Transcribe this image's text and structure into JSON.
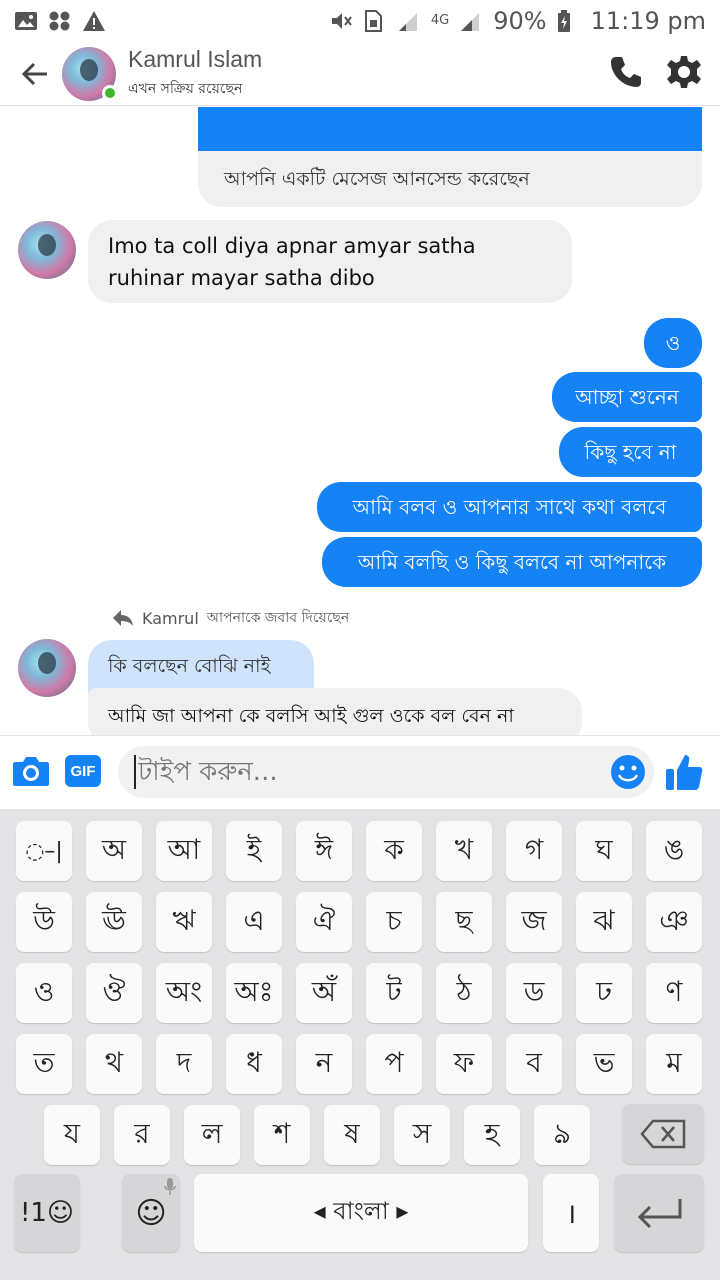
{
  "status_bar": {
    "battery": "90%",
    "time": "11:19 pm",
    "network": "4G"
  },
  "header": {
    "name": "Kamrul Islam",
    "status": "এখন সক্রিয় রয়েছেন"
  },
  "messages": {
    "unsent_note": "আপনি একটি মেসেজ আনসেন্ড করেছেন",
    "incoming_1": "Imo ta coll diya apnar amyar satha ruhinar mayar satha dibo",
    "out_1": "ও",
    "out_2": "আচ্ছা শুনেন",
    "out_3": "কিছু হবে না",
    "out_4": "আমি বলব ও আপনার সাথে কথা বলবে",
    "out_5": "আমি বলছি ও কিছু বলবে না আপনাকে",
    "reply_note_name": "Kamrul",
    "reply_note_text": "আপনাকে জবাব দিয়েছেন",
    "incoming_quote": "কি বলছেন বোঝি নাই",
    "incoming_2": "আমি জা আপনা কে বলসি আই গুল ওকে বল বেন না"
  },
  "composer": {
    "placeholder": "টাইপ করুন...",
    "gif_label": "GIF"
  },
  "keyboard": {
    "rows": [
      [
        "◌–|",
        "অ",
        "আ",
        "ই",
        "ঈ",
        "ক",
        "খ",
        "গ",
        "ঘ",
        "ঙ"
      ],
      [
        "উ",
        "ঊ",
        "ঋ",
        "এ",
        "ঐ",
        "চ",
        "ছ",
        "জ",
        "ঝ",
        "ঞ"
      ],
      [
        "ও",
        "ঔ",
        "অং",
        "অঃ",
        "অঁ",
        "ট",
        "ঠ",
        "ড",
        "ঢ",
        "ণ"
      ],
      [
        "ত",
        "থ",
        "দ",
        "ধ",
        "ন",
        "প",
        "ফ",
        "ব",
        "ভ",
        "ম"
      ],
      [
        "য",
        "র",
        "ল",
        "শ",
        "ষ",
        "স",
        "হ",
        "ঌ"
      ]
    ],
    "symbols_label": "!1☺",
    "emoji_label": "☺",
    "space_label": "◂ বাংলা ▸",
    "period_label": "।"
  },
  "colors": {
    "accent": "#1583f5",
    "online": "#42b72a",
    "incoming_bubble": "#f1f0f0",
    "quote_bubble": "#cfe3fb",
    "keyboard_bg": "#e3e3e5"
  }
}
